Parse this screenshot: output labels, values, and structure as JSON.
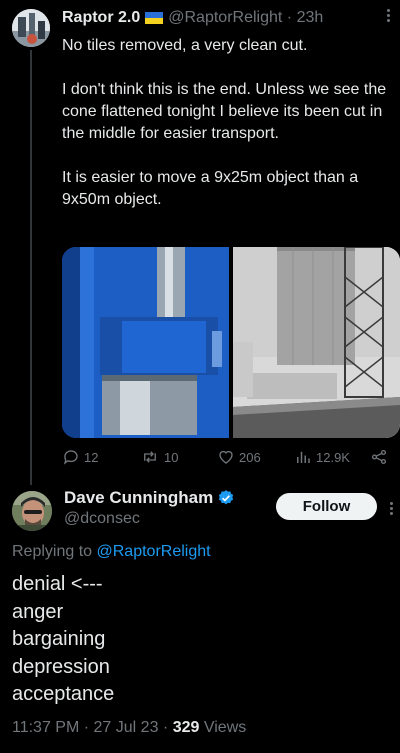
{
  "tweet1": {
    "author_name": "Raptor 2.0",
    "handle": "@RaptorRelight",
    "separator": "·",
    "time": "23h",
    "paragraphs": [
      "No tiles removed, a very clean cut.",
      "I don't think this is the end. Unless we see the cone flattened tonight I believe its been cut in the middle for easier transport.",
      "It is easier to move a 9x25m object than a 9x50m object."
    ],
    "stats": {
      "replies": "12",
      "reposts": "10",
      "likes": "206",
      "views": "12.9K"
    }
  },
  "tweet2": {
    "author_name": "Dave Cunningham",
    "handle": "@dconsec",
    "follow_label": "Follow",
    "replying_prefix": "Replying to",
    "replying_handle": "@RaptorRelight",
    "lines": [
      "denial <---",
      "anger",
      "bargaining",
      "depression",
      "acceptance"
    ],
    "time": "11:37 PM",
    "date": "27 Jul 23",
    "views_count": "329",
    "views_label": "Views"
  },
  "colors": {
    "background": "#000000",
    "text": "#e7e9ea",
    "muted": "#71767b",
    "link": "#1d9bf0",
    "verified": "#1d9bf0"
  }
}
